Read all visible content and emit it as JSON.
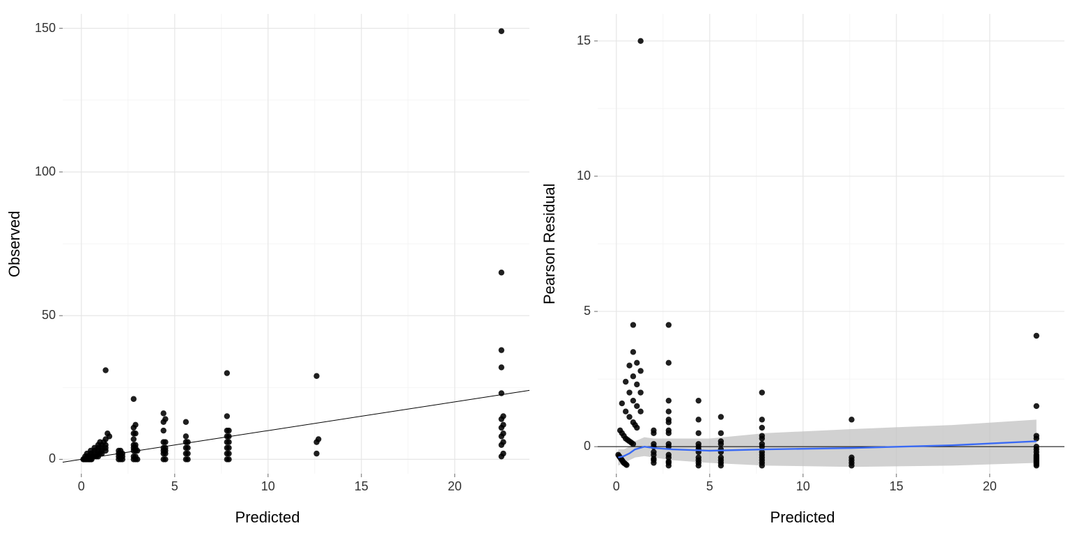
{
  "chart_data": [
    {
      "type": "scatter",
      "title": "",
      "xlabel": "Predicted",
      "ylabel": "Observed",
      "xlim": [
        -1,
        24
      ],
      "ylim": [
        -5,
        155
      ],
      "x_ticks": [
        0,
        5,
        10,
        15,
        20
      ],
      "y_ticks": [
        0,
        50,
        100,
        150
      ],
      "grid": true,
      "abline": {
        "slope": 1,
        "intercept": 0
      },
      "points": [
        [
          0.1,
          0
        ],
        [
          0.15,
          0
        ],
        [
          0.2,
          0
        ],
        [
          0.25,
          0
        ],
        [
          0.3,
          0
        ],
        [
          0.35,
          0
        ],
        [
          0.4,
          0
        ],
        [
          0.45,
          0
        ],
        [
          0.5,
          0
        ],
        [
          0.55,
          0
        ],
        [
          0.2,
          1
        ],
        [
          0.3,
          1
        ],
        [
          0.4,
          1
        ],
        [
          0.5,
          1
        ],
        [
          0.6,
          1
        ],
        [
          0.7,
          1
        ],
        [
          0.8,
          1
        ],
        [
          0.9,
          1
        ],
        [
          0.3,
          2
        ],
        [
          0.5,
          2
        ],
        [
          0.7,
          2
        ],
        [
          0.9,
          2
        ],
        [
          1.0,
          2
        ],
        [
          1.1,
          2
        ],
        [
          0.5,
          3
        ],
        [
          0.7,
          3
        ],
        [
          0.9,
          3
        ],
        [
          1.1,
          3
        ],
        [
          1.3,
          3
        ],
        [
          0.7,
          4
        ],
        [
          0.9,
          4
        ],
        [
          1.1,
          4
        ],
        [
          1.3,
          4
        ],
        [
          0.9,
          5
        ],
        [
          1.1,
          5
        ],
        [
          1.3,
          5
        ],
        [
          1.0,
          6
        ],
        [
          1.2,
          6
        ],
        [
          1.3,
          7
        ],
        [
          1.5,
          8
        ],
        [
          1.4,
          9
        ],
        [
          1.3,
          31
        ],
        [
          2.0,
          0
        ],
        [
          2.1,
          0
        ],
        [
          2.2,
          0
        ],
        [
          2.0,
          1
        ],
        [
          2.1,
          1
        ],
        [
          2.2,
          1
        ],
        [
          2.0,
          2
        ],
        [
          2.1,
          2
        ],
        [
          2.2,
          2
        ],
        [
          2.0,
          3
        ],
        [
          2.1,
          3
        ],
        [
          2.8,
          0
        ],
        [
          2.9,
          0
        ],
        [
          3.0,
          0
        ],
        [
          2.8,
          1
        ],
        [
          2.9,
          1
        ],
        [
          2.8,
          3
        ],
        [
          2.9,
          3
        ],
        [
          3.0,
          3
        ],
        [
          2.8,
          4
        ],
        [
          2.9,
          4
        ],
        [
          2.8,
          5
        ],
        [
          2.9,
          5
        ],
        [
          2.8,
          7
        ],
        [
          2.8,
          9
        ],
        [
          2.9,
          9
        ],
        [
          2.8,
          11
        ],
        [
          2.9,
          12
        ],
        [
          2.8,
          21
        ],
        [
          4.4,
          0
        ],
        [
          4.5,
          0
        ],
        [
          4.4,
          2
        ],
        [
          4.5,
          2
        ],
        [
          4.4,
          3
        ],
        [
          4.5,
          3
        ],
        [
          4.4,
          4
        ],
        [
          4.5,
          4
        ],
        [
          4.4,
          6
        ],
        [
          4.5,
          6
        ],
        [
          4.4,
          10
        ],
        [
          4.4,
          13
        ],
        [
          4.5,
          14
        ],
        [
          4.4,
          16
        ],
        [
          5.6,
          0
        ],
        [
          5.7,
          0
        ],
        [
          5.6,
          2
        ],
        [
          5.7,
          2
        ],
        [
          5.6,
          4
        ],
        [
          5.7,
          4
        ],
        [
          5.6,
          6
        ],
        [
          5.7,
          6
        ],
        [
          5.6,
          8
        ],
        [
          5.6,
          13
        ],
        [
          7.8,
          0
        ],
        [
          7.9,
          0
        ],
        [
          7.8,
          2
        ],
        [
          7.9,
          2
        ],
        [
          7.8,
          4
        ],
        [
          7.9,
          4
        ],
        [
          7.8,
          6
        ],
        [
          7.9,
          6
        ],
        [
          7.8,
          8
        ],
        [
          7.9,
          8
        ],
        [
          7.8,
          10
        ],
        [
          7.9,
          10
        ],
        [
          7.8,
          15
        ],
        [
          7.8,
          30
        ],
        [
          12.6,
          2
        ],
        [
          12.6,
          6
        ],
        [
          12.7,
          7
        ],
        [
          12.6,
          29
        ],
        [
          22.5,
          1
        ],
        [
          22.6,
          2
        ],
        [
          22.5,
          5
        ],
        [
          22.6,
          6
        ],
        [
          22.5,
          8
        ],
        [
          22.6,
          9
        ],
        [
          22.5,
          11
        ],
        [
          22.6,
          12
        ],
        [
          22.5,
          14
        ],
        [
          22.6,
          15
        ],
        [
          22.5,
          23
        ],
        [
          22.5,
          32
        ],
        [
          22.5,
          38
        ],
        [
          22.5,
          65
        ],
        [
          22.5,
          149
        ]
      ]
    },
    {
      "type": "scatter",
      "title": "",
      "xlabel": "Predicted",
      "ylabel": "Pearson Residual",
      "xlim": [
        -1,
        24
      ],
      "ylim": [
        -1,
        16
      ],
      "x_ticks": [
        0,
        5,
        10,
        15,
        20
      ],
      "y_ticks": [
        0,
        5,
        10,
        15
      ],
      "grid": true,
      "hline": 0,
      "smooth": {
        "x": [
          0.1,
          0.4,
          0.7,
          1.0,
          1.5,
          2.0,
          3.0,
          5.0,
          8.0,
          12.6,
          18.0,
          22.5
        ],
        "y": [
          -0.4,
          -0.35,
          -0.25,
          -0.1,
          0.0,
          -0.05,
          -0.1,
          -0.15,
          -0.1,
          -0.05,
          0.05,
          0.2
        ],
        "ci_low": [
          -0.7,
          -0.6,
          -0.5,
          -0.4,
          -0.35,
          -0.4,
          -0.5,
          -0.6,
          -0.7,
          -0.75,
          -0.7,
          -0.6
        ],
        "ci_high": [
          -0.1,
          -0.1,
          0.0,
          0.2,
          0.35,
          0.3,
          0.3,
          0.3,
          0.5,
          0.65,
          0.8,
          1.0
        ]
      },
      "points": [
        [
          0.1,
          -0.3
        ],
        [
          0.15,
          -0.35
        ],
        [
          0.2,
          -0.4
        ],
        [
          0.25,
          -0.45
        ],
        [
          0.3,
          -0.5
        ],
        [
          0.35,
          -0.55
        ],
        [
          0.4,
          -0.6
        ],
        [
          0.45,
          -0.62
        ],
        [
          0.5,
          -0.65
        ],
        [
          0.55,
          -0.68
        ],
        [
          0.2,
          0.6
        ],
        [
          0.3,
          0.5
        ],
        [
          0.4,
          0.4
        ],
        [
          0.5,
          0.3
        ],
        [
          0.6,
          0.25
        ],
        [
          0.7,
          0.2
        ],
        [
          0.8,
          0.15
        ],
        [
          0.9,
          0.1
        ],
        [
          0.3,
          1.6
        ],
        [
          0.5,
          1.3
        ],
        [
          0.7,
          1.1
        ],
        [
          0.9,
          0.9
        ],
        [
          1.0,
          0.8
        ],
        [
          1.1,
          0.7
        ],
        [
          0.5,
          2.4
        ],
        [
          0.7,
          2.0
        ],
        [
          0.9,
          1.7
        ],
        [
          1.1,
          1.5
        ],
        [
          1.3,
          1.3
        ],
        [
          0.7,
          3.0
        ],
        [
          0.9,
          2.6
        ],
        [
          1.1,
          2.3
        ],
        [
          1.3,
          2.0
        ],
        [
          0.9,
          3.5
        ],
        [
          1.1,
          3.1
        ],
        [
          1.3,
          2.8
        ],
        [
          0.9,
          4.5
        ],
        [
          1.3,
          15.0
        ],
        [
          2.0,
          -0.6
        ],
        [
          2.0,
          -0.5
        ],
        [
          2.0,
          -0.45
        ],
        [
          2.0,
          -0.3
        ],
        [
          2.0,
          -0.2
        ],
        [
          2.0,
          0.1
        ],
        [
          2.0,
          0.0
        ],
        [
          2.0,
          0.5
        ],
        [
          2.0,
          0.6
        ],
        [
          2.8,
          -0.7
        ],
        [
          2.8,
          -0.6
        ],
        [
          2.8,
          -0.55
        ],
        [
          2.8,
          -0.4
        ],
        [
          2.8,
          -0.3
        ],
        [
          2.8,
          0.0
        ],
        [
          2.8,
          0.1
        ],
        [
          2.8,
          0.5
        ],
        [
          2.8,
          0.6
        ],
        [
          2.8,
          0.9
        ],
        [
          2.8,
          1.0
        ],
        [
          2.8,
          1.3
        ],
        [
          2.8,
          1.7
        ],
        [
          2.8,
          3.1
        ],
        [
          2.8,
          4.5
        ],
        [
          4.4,
          -0.7
        ],
        [
          4.4,
          -0.6
        ],
        [
          4.4,
          -0.5
        ],
        [
          4.4,
          -0.4
        ],
        [
          4.4,
          -0.2
        ],
        [
          4.4,
          -0.1
        ],
        [
          4.4,
          0.0
        ],
        [
          4.4,
          0.1
        ],
        [
          4.4,
          0.5
        ],
        [
          4.4,
          1.0
        ],
        [
          4.4,
          1.7
        ],
        [
          5.6,
          -0.7
        ],
        [
          5.6,
          -0.6
        ],
        [
          5.6,
          -0.5
        ],
        [
          5.6,
          -0.4
        ],
        [
          5.6,
          -0.2
        ],
        [
          5.6,
          -0.1
        ],
        [
          5.6,
          0.1
        ],
        [
          5.6,
          0.2
        ],
        [
          5.6,
          0.5
        ],
        [
          5.6,
          1.1
        ],
        [
          7.8,
          -0.7
        ],
        [
          7.8,
          -0.6
        ],
        [
          7.8,
          -0.5
        ],
        [
          7.8,
          -0.4
        ],
        [
          7.8,
          -0.3
        ],
        [
          7.8,
          -0.2
        ],
        [
          7.8,
          0.0
        ],
        [
          7.8,
          0.1
        ],
        [
          7.8,
          0.3
        ],
        [
          7.8,
          0.4
        ],
        [
          7.8,
          0.7
        ],
        [
          7.8,
          1.0
        ],
        [
          7.8,
          2.0
        ],
        [
          12.6,
          -0.7
        ],
        [
          12.6,
          -0.6
        ],
        [
          12.6,
          -0.5
        ],
        [
          12.6,
          -0.4
        ],
        [
          12.6,
          1.0
        ],
        [
          22.5,
          -0.7
        ],
        [
          22.5,
          -0.65
        ],
        [
          22.5,
          -0.6
        ],
        [
          22.5,
          -0.55
        ],
        [
          22.5,
          -0.5
        ],
        [
          22.5,
          -0.45
        ],
        [
          22.5,
          -0.4
        ],
        [
          22.5,
          -0.35
        ],
        [
          22.5,
          -0.3
        ],
        [
          22.5,
          -0.2
        ],
        [
          22.5,
          -0.1
        ],
        [
          22.5,
          0.0
        ],
        [
          22.5,
          0.3
        ],
        [
          22.5,
          0.4
        ],
        [
          22.5,
          1.5
        ],
        [
          22.5,
          4.1
        ]
      ]
    }
  ],
  "left": {
    "xlabel": "Predicted",
    "ylabel": "Observed",
    "x_ticks": [
      "0",
      "5",
      "10",
      "15",
      "20"
    ],
    "y_ticks": [
      "0",
      "50",
      "100",
      "150"
    ]
  },
  "right": {
    "xlabel": "Predicted",
    "ylabel": "Pearson Residual",
    "x_ticks": [
      "0",
      "5",
      "10",
      "15",
      "20"
    ],
    "y_ticks": [
      "0",
      "5",
      "10",
      "15"
    ]
  }
}
